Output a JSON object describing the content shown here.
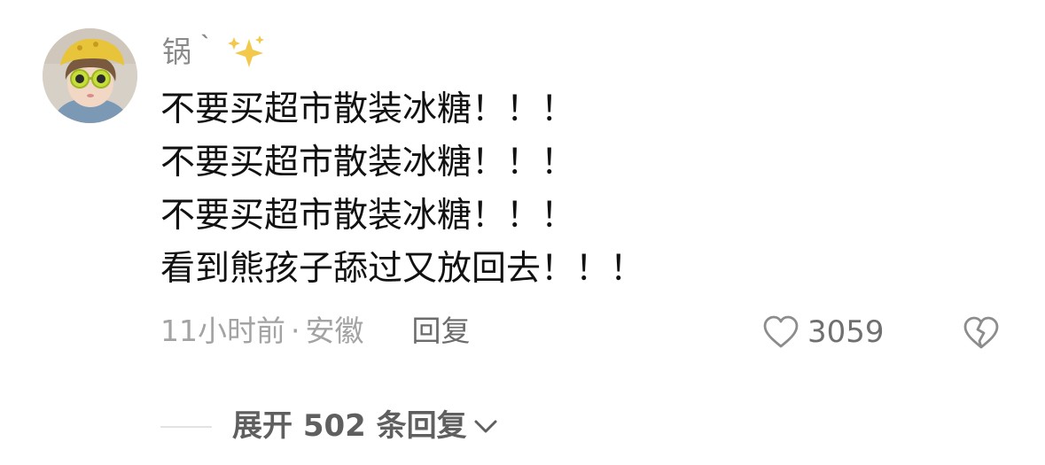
{
  "comment": {
    "username": "锅｀",
    "lines": [
      "不要买超市散装冰糖！！！",
      "不要买超市散装冰糖！！！",
      "不要买超市散装冰糖！！！",
      "看到熊孩子舔过又放回去！！！"
    ],
    "time": "11小时前",
    "separator": "·",
    "location": "安徽",
    "reply_label": "回复",
    "like_count": "3059",
    "expand_label": "展开 502 条回复",
    "icons": {
      "avatar": "avatar-child-yellow-hat",
      "sparkle": "sparkles-icon",
      "like": "heart-outline-icon",
      "dislike": "broken-heart-icon",
      "expand": "chevron-down-icon"
    },
    "colors": {
      "text": "#111111",
      "muted": "#a3a3a3",
      "sparkle": "#f2c94c"
    }
  }
}
